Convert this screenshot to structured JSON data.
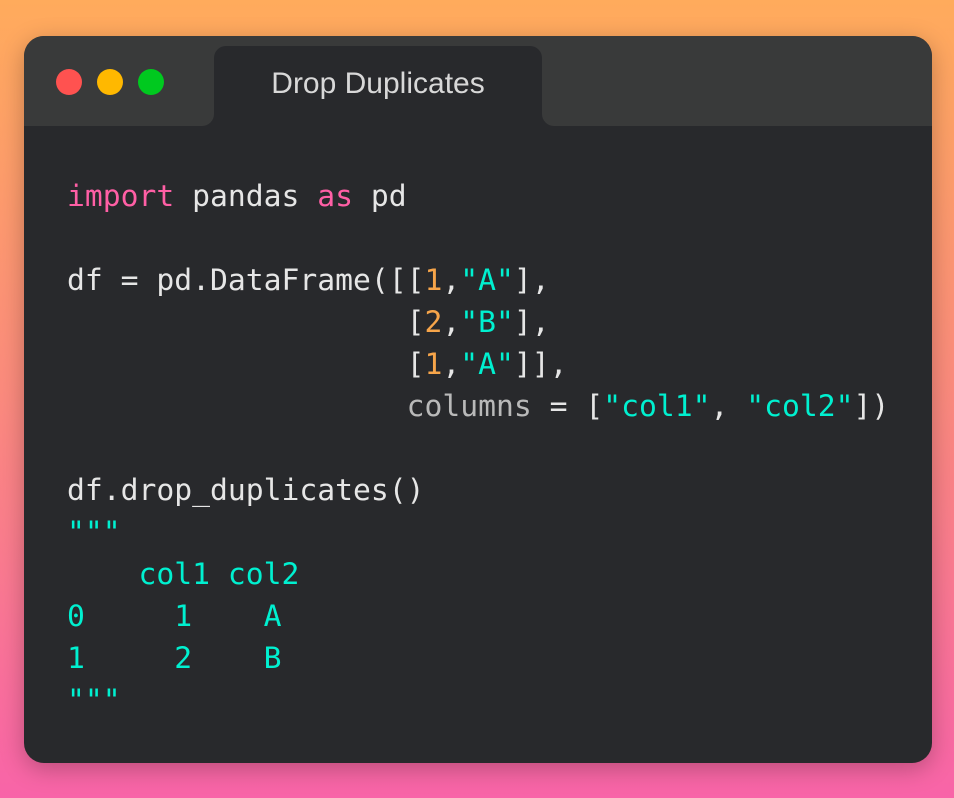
{
  "window": {
    "title": "Drop Duplicates",
    "controls": [
      "close",
      "minimize",
      "maximize"
    ],
    "colors": {
      "close": "#ff5250",
      "minimize": "#ffb800",
      "maximize": "#00c91f"
    }
  },
  "code": {
    "line1": {
      "kw1": "import",
      "t1": " pandas ",
      "kw2": "as",
      "t2": " pd"
    },
    "line3": {
      "t1": "df = pd.DataFrame([[",
      "n1": "1",
      "t2": ",",
      "s1": "\"A\"",
      "t3": "],"
    },
    "line4": {
      "indent": "                   ",
      "t1": "[",
      "n1": "2",
      "t2": ",",
      "s1": "\"B\"",
      "t3": "],"
    },
    "line5": {
      "indent": "                   ",
      "t1": "[",
      "n1": "1",
      "t2": ",",
      "s1": "\"A\"",
      "t3": "]],"
    },
    "line6": {
      "indent": "                   ",
      "kwarg": "columns",
      "t1": " = [",
      "s1": "\"col1\"",
      "t2": ", ",
      "s2": "\"col2\"",
      "t3": "])"
    },
    "line8": "df.drop_duplicates()",
    "output": [
      "\"\"\"",
      "    col1 col2",
      "0     1    A",
      "1     2    B",
      "\"\"\""
    ]
  },
  "colors": {
    "keyword": "#ff5fa5",
    "number": "#f7a54a",
    "string": "#00f0d0",
    "text": "#e6e6e6"
  }
}
